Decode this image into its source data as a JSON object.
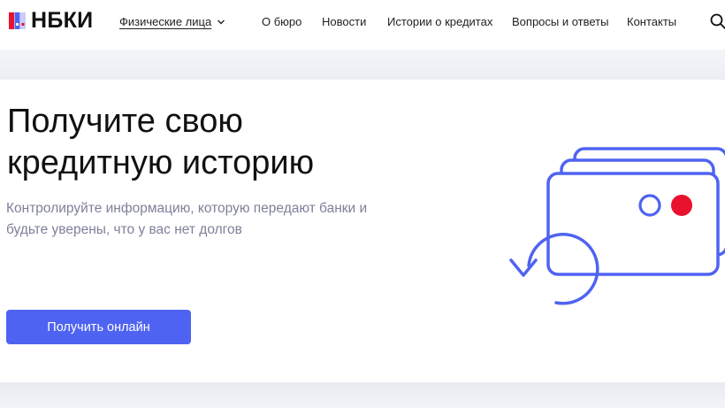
{
  "header": {
    "logo_text": "НБКИ",
    "segment_label": "Физические лица",
    "nav": [
      "О бюро",
      "Новости",
      "Истории о кредитах",
      "Вопросы и ответы",
      "Контакты"
    ]
  },
  "hero": {
    "title_line1": "Получите свою",
    "title_line2": "кредитную историю",
    "subtitle_line1": "Контролируйте информацию, которую передают банки и",
    "subtitle_line2": "будьте уверены, что у вас нет долгов",
    "cta_label": "Получить онлайн"
  },
  "icons": {
    "logo": "nbki-logo-icon",
    "segment_toggle": "chevron-down-icon",
    "search": "search-icon",
    "illustration": "credit-cards-refresh-illustration"
  },
  "colors": {
    "accent": "#4f63f2",
    "illustration_red": "#e8122e",
    "subtitle": "#7e809a"
  }
}
